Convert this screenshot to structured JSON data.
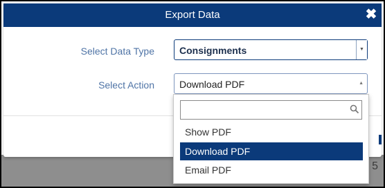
{
  "dialog": {
    "title": "Export Data",
    "close_glyph": "✖"
  },
  "fields": {
    "data_type": {
      "label": "Select Data Type",
      "value": "Consignments"
    },
    "action": {
      "label": "Select Action",
      "value": "Download PDF"
    }
  },
  "dropdown": {
    "search_value": "",
    "options": [
      {
        "label": "Show PDF",
        "selected": false
      },
      {
        "label": "Download PDF",
        "selected": true
      },
      {
        "label": "Email PDF",
        "selected": false
      }
    ]
  },
  "background": {
    "partial_text": "5"
  },
  "colors": {
    "header": "#0b3a7a",
    "label": "#4f74a6",
    "selected_option": "#0b3a7a"
  },
  "icons": [
    "close-icon",
    "chevron-down-icon",
    "chevron-up-icon",
    "search-icon"
  ]
}
